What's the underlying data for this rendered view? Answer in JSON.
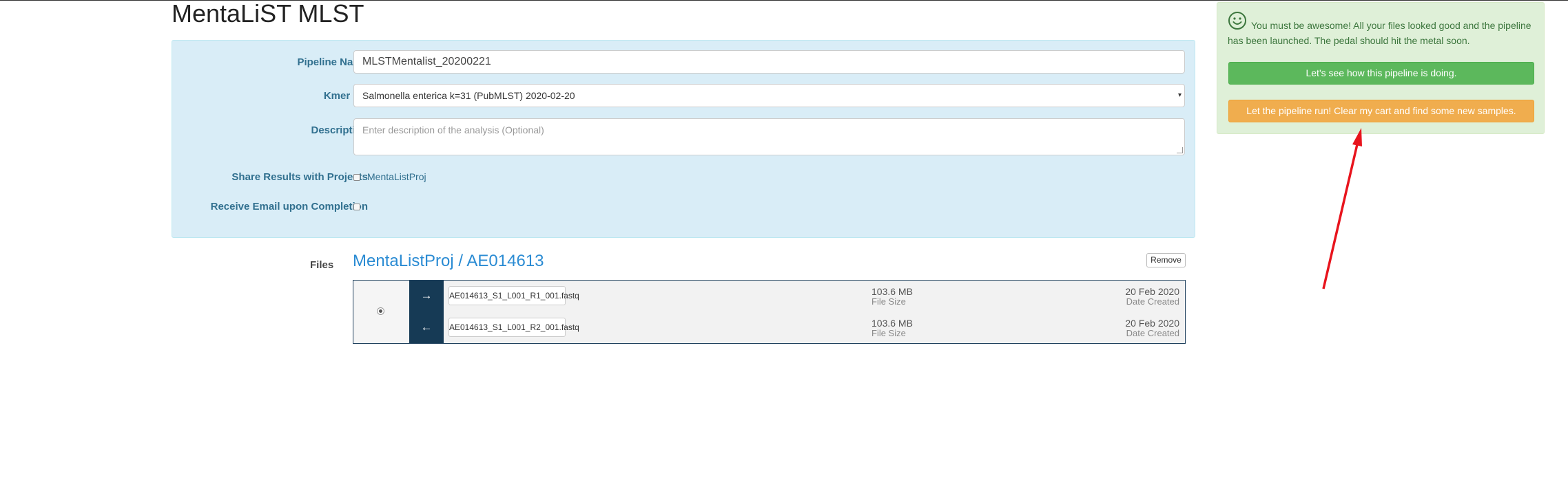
{
  "page": {
    "title": "MentaLiST MLST"
  },
  "form": {
    "pipeline_name_label": "Pipeline Name",
    "pipeline_name_value": "MLSTMentalist_20200221",
    "kmer_db_label": "Kmer DB",
    "kmer_db_selected": "Salmonella enterica k=31 (PubMLST) 2020-02-20",
    "description_label": "Description",
    "description_placeholder": "Enter description of the analysis (Optional)",
    "share_label": "Share Results with Projects",
    "share_project": "MentaListProj",
    "email_label": "Receive Email upon Completion"
  },
  "files": {
    "label": "Files",
    "heading": "MentaListProj / AE014613",
    "remove_label": "Remove",
    "items": [
      {
        "name": "AE014613_S1_L001_R1_001.fastq",
        "size": "103.6 MB",
        "size_label": "File Size",
        "date": "20 Feb 2020",
        "date_label": "Date Created",
        "direction_icon": "arrow-right-icon"
      },
      {
        "name": "AE014613_S1_L001_R2_001.fastq",
        "size": "103.6 MB",
        "size_label": "File Size",
        "date": "20 Feb 2020",
        "date_label": "Date Created",
        "direction_icon": "arrow-left-icon"
      }
    ]
  },
  "alert": {
    "icon": "smiley-icon",
    "message": "You must be awesome! All your files looked good and the pipeline has been launched. The pedal should hit the metal soon.",
    "primary_button": "Let's see how this pipeline is doing.",
    "secondary_button": "Let the pipeline run! Clear my cart and find some new samples."
  },
  "colors": {
    "panel_info": "#d9edf7",
    "panel_success": "#dff0d8",
    "button_success": "#5cb85c",
    "button_warning": "#f0ad4e",
    "files_heading": "#2a8bd3",
    "annotation_arrow": "#e8141d"
  }
}
